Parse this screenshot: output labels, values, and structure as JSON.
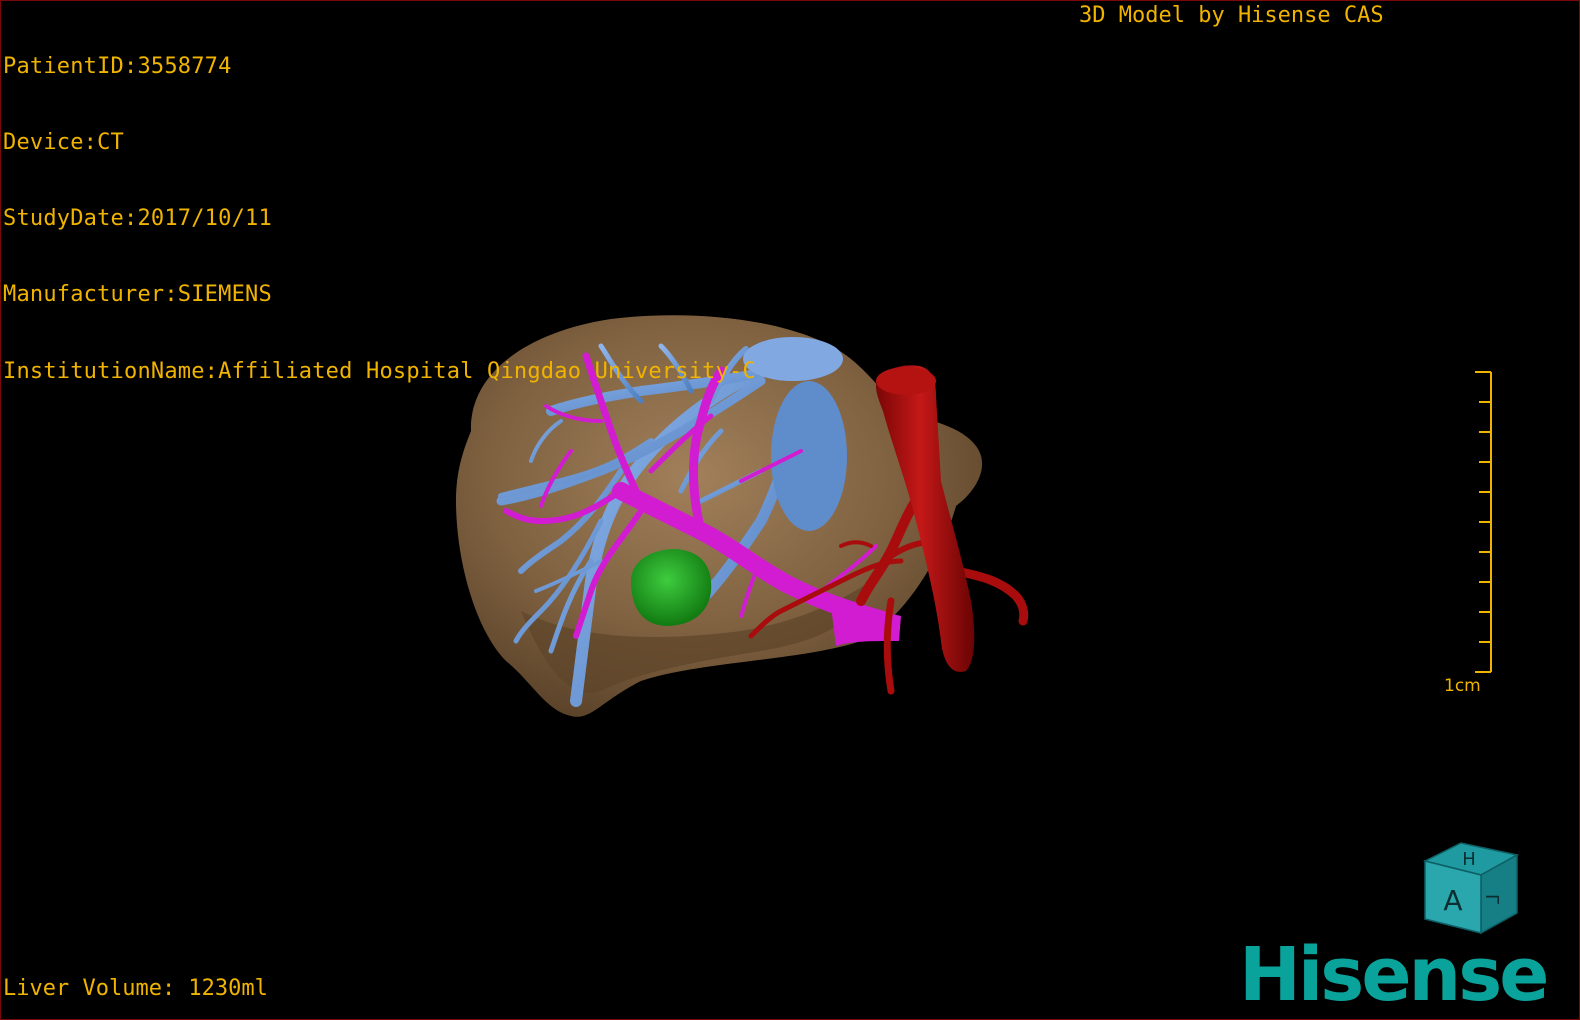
{
  "overlay": {
    "patient_id_line": "PatientID:3558774",
    "device_line": "Device:CT",
    "study_date_line": "StudyDate:2017/10/11",
    "manufacturer_line": "Manufacturer:SIEMENS",
    "institution_line": "InstitutionName:Affiliated Hospital Qingdao University-C",
    "credit": "3D Model by Hisense CAS",
    "liver_volume": "Liver Volume: 1230ml"
  },
  "scale_bar": {
    "label": "1cm",
    "ticks": 10
  },
  "orientation_cube": {
    "face_front": "A",
    "face_top": "H",
    "face_side": "L"
  },
  "brand": {
    "logo_text": "Hisense"
  },
  "colors": {
    "overlay_text": "#f0b400",
    "liver": "#8a6a42",
    "hepatic_veins": "#6f9ad8",
    "portal_vein": "#d21cd2",
    "arteries_aorta": "#a80c0c",
    "lesion": "#1fa21f",
    "brand": "#0aa39b",
    "border": "#7a0a0a"
  }
}
